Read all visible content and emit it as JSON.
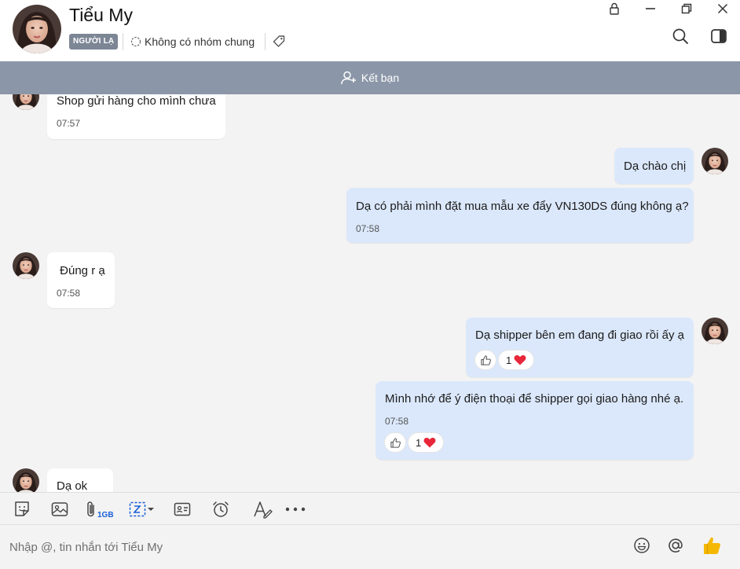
{
  "header": {
    "contact_name": "Tiểu My",
    "badge": "NGƯỜI LẠ",
    "group_info": "Không có nhóm chung"
  },
  "friend_bar": {
    "label": "Kết bạn"
  },
  "messages": [
    {
      "text": "Shop gửi hàng cho mình chưa",
      "time": "07:57"
    },
    {
      "text": "Dạ chào chị"
    },
    {
      "text": "Dạ có phải mình đặt mua mẫu xe đẩy VN130DS đúng không ạ?",
      "time": "07:58"
    },
    {
      "text": " Đúng r ạ",
      "time": "07:58"
    },
    {
      "text": "Dạ shipper bên em đang đi giao rồi ấy ạ",
      "reaction_count": "1"
    },
    {
      "text": "Mình nhớ để ý điện thoại để shipper gọi giao hàng nhé ạ.",
      "time": "07:58",
      "reaction_count": "1"
    },
    {
      "text": "Dạ ok"
    }
  ],
  "toolbar": {
    "file_size_label": "1GB"
  },
  "composer": {
    "placeholder": "Nhập @, tin nhắn tới Tiểu My"
  },
  "colors": {
    "friend_bar": "#8b97a8",
    "outgoing_bubble": "#dbe8fb",
    "incoming_bubble": "#ffffff",
    "reaction_heart": "#e8263a",
    "like_button": "#f5b800"
  },
  "icons": [
    "lock-icon",
    "minimize-icon",
    "restore-icon",
    "close-icon",
    "search-icon",
    "panel-toggle-icon",
    "add-friend-icon",
    "tag-icon",
    "sticker-icon",
    "image-icon",
    "attach-icon",
    "screenshot-icon",
    "contact-card-icon",
    "reminder-icon",
    "format-text-icon",
    "more-icon",
    "emoji-icon",
    "mention-icon",
    "thumbs-up-icon"
  ]
}
